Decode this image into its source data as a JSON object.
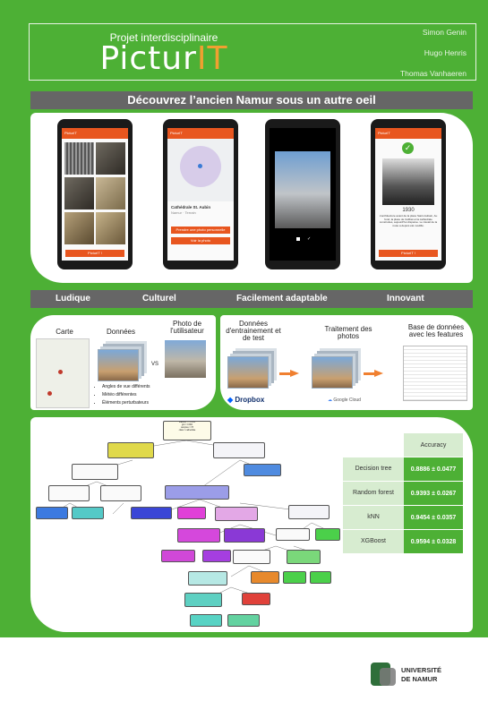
{
  "header": {
    "subtitle": "Projet interdisciplinaire",
    "logo_main": "Pictur",
    "logo_accent": "IT",
    "authors": [
      "Simon Genin",
      "Hugo Henris",
      "Thomas Vanhaeren"
    ]
  },
  "tagline": "Découvrez l’ancien Namur sous un autre oeil",
  "app_screens": {
    "app_name": "PicturIT",
    "button_main": "PicturIT !",
    "place_name": "Cathédrale St. Aubin",
    "place_sub": "Namur · Terrain",
    "btn_take_photo": "Prendre une photo personnelle",
    "btn_see_more": "Voir la photo",
    "year": "1930",
    "description": "L'architecture avant de la place Saint-Aubain, Au fond, la place de Célibat et la cathédrale construites, aujourd'hui disparue. Le travail de la route a depuis été modifié."
  },
  "features": [
    "Ludique",
    "Culturel",
    "Facilement adaptable",
    "Innovant"
  ],
  "pipeline_left": {
    "carte": "Carte",
    "donnees": "Données",
    "photo_user": "Photo de l'utilisateur",
    "vs": "VS",
    "bullets": [
      "Angles de vue différents",
      "Météo différentes",
      "Éléments perturbateurs"
    ]
  },
  "pipeline_right": {
    "train": "Données d'entrainement et de test",
    "processing": "Traitement des photos",
    "db": "Base de données avec les features",
    "dropbox": "Dropbox",
    "gcloud": "Google Cloud"
  },
  "accuracy_table": {
    "header": "Accuracy",
    "rows": [
      {
        "model": "Decision tree",
        "value": "0.8886 ± 0.0477"
      },
      {
        "model": "Random forest",
        "value": "0.9393 ± 0.0267"
      },
      {
        "model": "kNN",
        "value": "0.9454 ± 0.0357"
      },
      {
        "model": "XGBoost",
        "value": "0.9594 ± 0.0328"
      }
    ]
  },
  "tree": {
    "root": "feature1 <= 0.123\ngini = 0.902\nsamples = 78\nclass = cathedrale",
    "true_label": "True",
    "false_label": "False"
  },
  "footer": {
    "university_line1": "UNIVERSITÉ",
    "university_line2": "DE NAMUR"
  },
  "colors": {
    "green": "#4db035",
    "grey_bar": "#666666",
    "orange": "#e8561f"
  }
}
